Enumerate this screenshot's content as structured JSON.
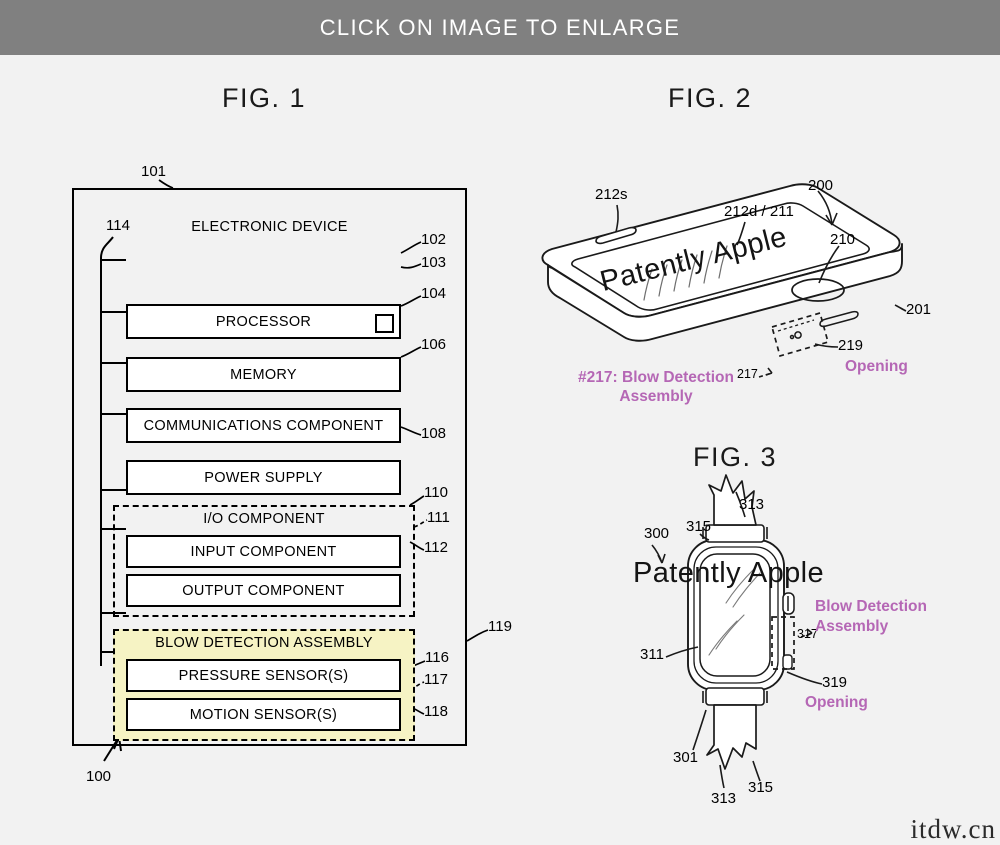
{
  "banner": {
    "text": "CLICK ON IMAGE TO ENLARGE"
  },
  "watermark": {
    "site": "itdw.cn"
  },
  "figures": [
    {
      "id": "fig1",
      "title": "FIG. 1",
      "outer_ref": "101",
      "device_label": "ELECTRONIC DEVICE",
      "bus_ref": "114",
      "assembly_ref": "100",
      "right_ref": "119",
      "blocks": [
        {
          "label": "PROCESSOR",
          "ref": "102",
          "sub_ref": "103"
        },
        {
          "label": "MEMORY",
          "ref": "104"
        },
        {
          "label": "COMMUNICATIONS COMPONENT",
          "ref": "106"
        },
        {
          "label": "POWER SUPPLY",
          "ref": "108"
        }
      ],
      "io_group": {
        "label": "I/O COMPONENT",
        "ref": "110",
        "mid_ref": "111",
        "blocks": [
          {
            "label": "INPUT COMPONENT",
            "ref": "111"
          },
          {
            "label": "OUTPUT COMPONENT",
            "ref": "112"
          }
        ]
      },
      "blow_group": {
        "label": "BLOW DETECTION ASSEMBLY",
        "mid_ref": "117",
        "blocks": [
          {
            "label": "PRESSURE SENSOR(S)",
            "ref": "116"
          },
          {
            "label": "MOTION SENSOR(S)",
            "ref": "118"
          }
        ]
      }
    },
    {
      "id": "fig2",
      "title": "FIG. 2",
      "screen_text": "Patently Apple",
      "refs": {
        "device": "200",
        "speaker": "212s",
        "display": "212d / 211",
        "home_button": "210",
        "body": "201",
        "opening_num": "219",
        "assembly_num": "217"
      },
      "annotations": {
        "assembly_line1": "#217: Blow Detection",
        "assembly_line2": "Assembly",
        "opening": "Opening"
      }
    },
    {
      "id": "fig3",
      "title": "FIG. 3",
      "screen_text": "Patently Apple",
      "refs": {
        "device": "300",
        "band_top": "313",
        "lug_top": "315",
        "display": "311",
        "body": "301",
        "assembly_num": "317",
        "opening_num": "319",
        "band_bottom": "313",
        "lug_bottom": "315"
      },
      "annotations": {
        "assembly_line1": "Blow Detection",
        "assembly_line2": "Assembly",
        "opening": "Opening"
      }
    }
  ],
  "colors": {
    "banner_bg": "#808080",
    "page_bg": "#f2f2f2",
    "highlight_yellow": "#f6f3c4",
    "annotation_purple": "#b567b5",
    "ink": "#000000"
  }
}
